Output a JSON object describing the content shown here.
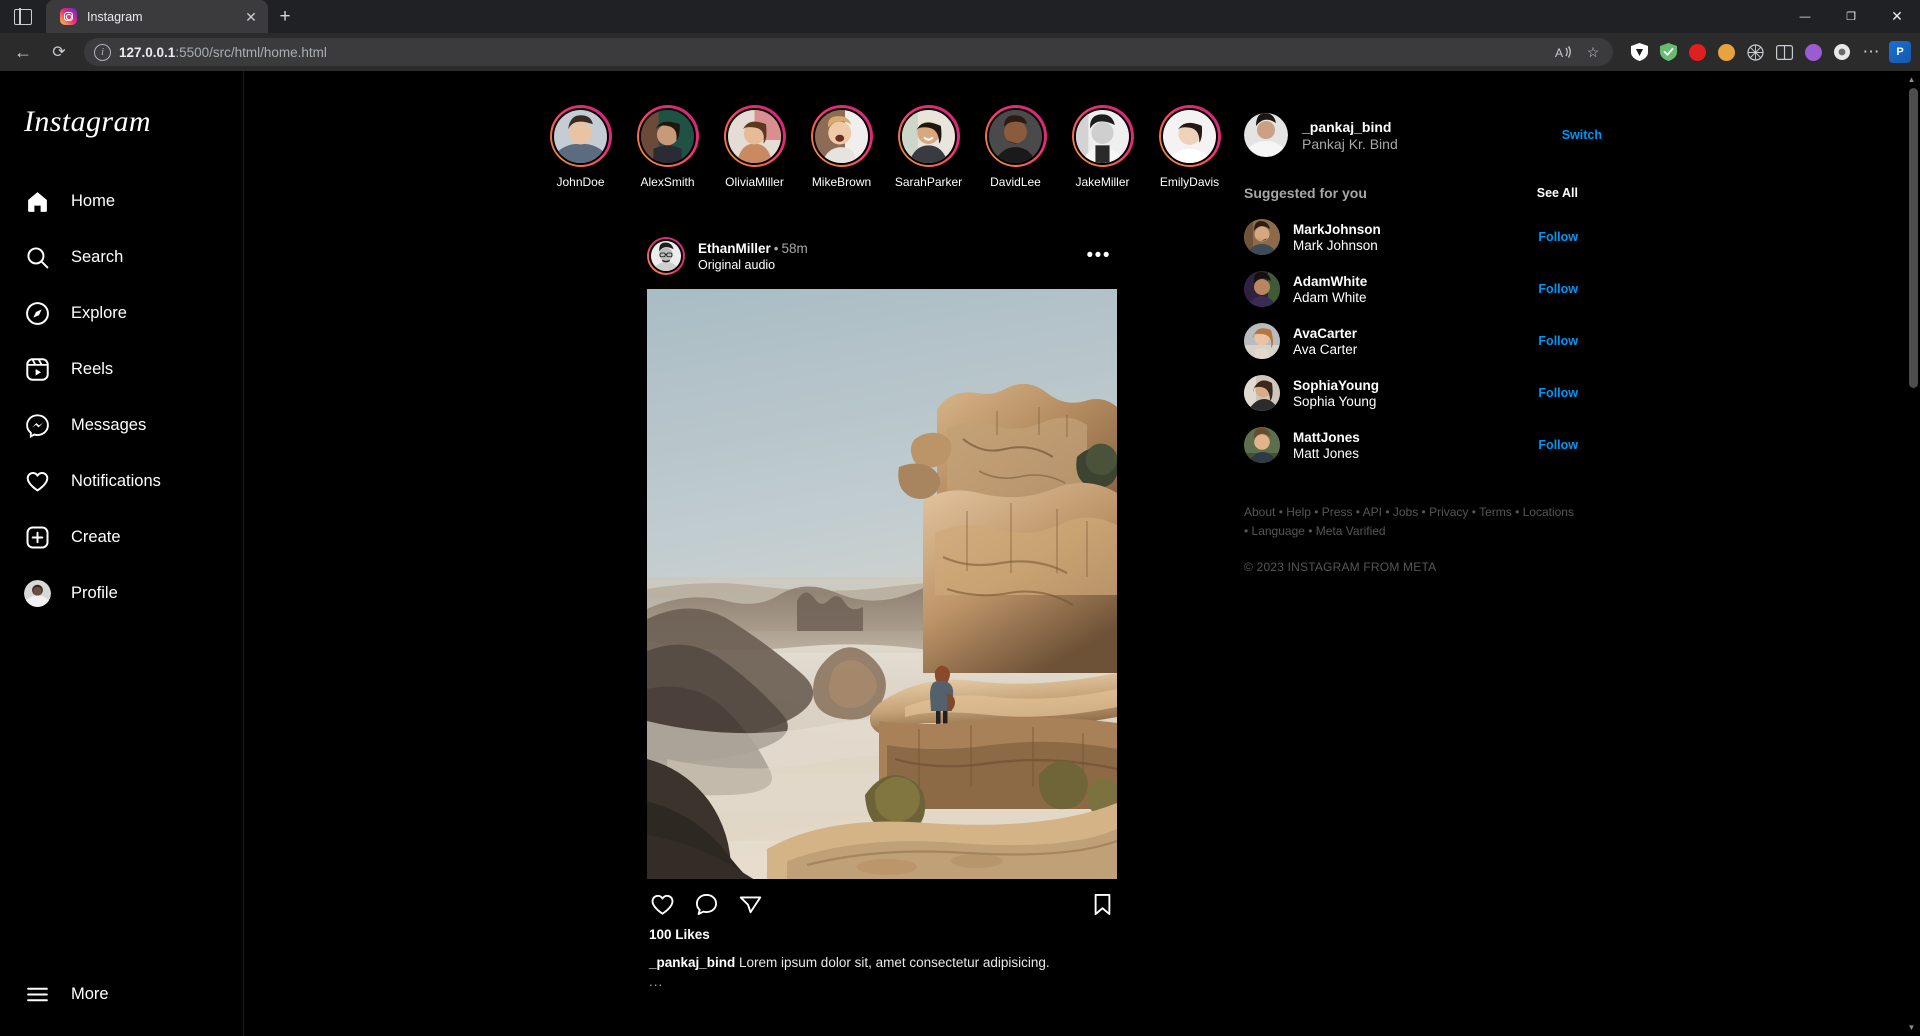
{
  "browser": {
    "tab": {
      "title": "Instagram",
      "favicon": "instagram-icon",
      "close": "✕"
    },
    "newtab_label": "+",
    "window_controls": {
      "minimize": "—",
      "maximize": "❐",
      "close": "✕"
    },
    "nav": {
      "back": "←",
      "reload": "⟳"
    },
    "url": {
      "host": "127.0.0.1",
      "rest": ":5500/src/html/home.html",
      "full": "127.0.0.1:5500/src/html/home.html"
    },
    "url_actions": {
      "read_aloud": "A",
      "favorite": "☆"
    },
    "extension_colors": [
      "#ffffff",
      "#68bc71",
      "#e02020",
      "#e8a33d",
      "#3a3a3a",
      "#9a5cd0",
      "#6f42c1"
    ],
    "profile_initial": "P",
    "settings_more": "⋯"
  },
  "sidebar": {
    "logo": "Instagram",
    "items": [
      {
        "label": "Home",
        "icon": "home-icon"
      },
      {
        "label": "Search",
        "icon": "search-icon"
      },
      {
        "label": "Explore",
        "icon": "compass-icon"
      },
      {
        "label": "Reels",
        "icon": "reels-icon"
      },
      {
        "label": "Messages",
        "icon": "messenger-icon"
      },
      {
        "label": "Notifications",
        "icon": "heart-icon"
      },
      {
        "label": "Create",
        "icon": "plus-square-icon"
      },
      {
        "label": "Profile",
        "icon": "avatar-icon"
      }
    ],
    "more": {
      "label": "More",
      "icon": "hamburger-icon"
    }
  },
  "stories": [
    {
      "name": "JohnDoe"
    },
    {
      "name": "AlexSmith"
    },
    {
      "name": "OliviaMiller"
    },
    {
      "name": "MikeBrown"
    },
    {
      "name": "SarahParker"
    },
    {
      "name": "DavidLee"
    },
    {
      "name": "JakeMiller"
    },
    {
      "name": "EmilyDavis"
    }
  ],
  "post": {
    "username": "EthanMiller",
    "separator": "•",
    "time": "58m",
    "audio": "Original audio",
    "more_menu": "•••",
    "image_alt": "person standing on canyon cliff edge at sunrise",
    "actions": {
      "like": "heart-icon",
      "comment": "comment-icon",
      "share": "share-icon",
      "save": "bookmark-icon"
    },
    "likes": "100 Likes",
    "caption_user": "_pankaj_bind",
    "caption_text": " Lorem ipsum dolor sit, amet consectetur adipisicing.",
    "caption_more": "..."
  },
  "rail": {
    "me": {
      "username": "_pankaj_bind",
      "fullname": "Pankaj Kr. Bind",
      "switch": "Switch"
    },
    "suggested_title": "Suggested for you",
    "see_all": "See All",
    "suggestions": [
      {
        "username": "MarkJohnson",
        "fullname": "Mark Johnson",
        "action": "Follow"
      },
      {
        "username": "AdamWhite",
        "fullname": "Adam White",
        "action": "Follow"
      },
      {
        "username": "AvaCarter",
        "fullname": "Ava Carter",
        "action": "Follow"
      },
      {
        "username": "SophiaYoung",
        "fullname": "Sophia Young",
        "action": "Follow"
      },
      {
        "username": "MattJones",
        "fullname": "Matt Jones",
        "action": "Follow"
      }
    ],
    "footer_links": "About • Help • Press • API • Jobs • Privacy • Terms • Locations • Language • Meta Varified",
    "copyright": "© 2023 INSTAGRAM FROM META"
  },
  "colors": {
    "accent_blue": "#0095f6",
    "background": "#000000",
    "muted": "#a8a8a8",
    "footer": "#565656"
  }
}
